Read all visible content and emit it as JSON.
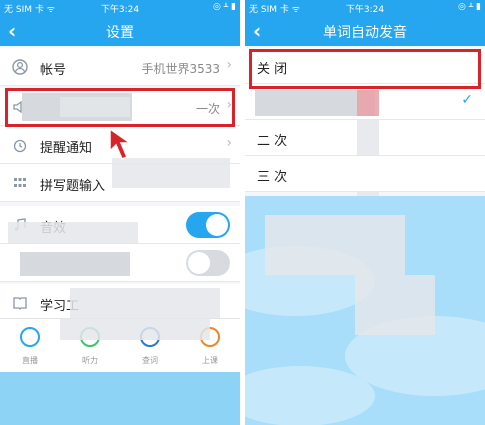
{
  "left": {
    "status": {
      "carrier": "无 SIM 卡 ᯤ",
      "time": "下午3:24",
      "icons": "◎ ᚆ ▮"
    },
    "nav": {
      "back": "‹",
      "title": "设置"
    },
    "rows": {
      "account": {
        "label": "帐号",
        "value": "手机世界3533",
        "icon": "person-icon"
      },
      "speaker": {
        "value": "一次",
        "icon": "speaker-icon"
      },
      "reminder": {
        "label": "提醒通知",
        "icon": "alarm-icon"
      },
      "spelling": {
        "label": "拼写题输入",
        "icon": "keypad-icon"
      },
      "sound": {
        "label": "音效"
      },
      "study": {
        "label": "学习工"
      }
    },
    "tabs": [
      {
        "label": "直播",
        "icon": "live-icon"
      },
      {
        "label": "听力",
        "icon": "listen-icon"
      },
      {
        "label": "查词",
        "icon": "dictionary-icon"
      },
      {
        "label": "上课",
        "icon": "class-icon"
      }
    ]
  },
  "right": {
    "status": {
      "carrier": "无 SIM 卡 ᯤ",
      "time": "下午3:24",
      "icons": "◎ ᚆ ▮"
    },
    "nav": {
      "back": "‹",
      "title": "单词自动发音"
    },
    "options": [
      {
        "label": "关 闭",
        "checked": false
      },
      {
        "label": "",
        "checked": true
      },
      {
        "label": "二 次",
        "checked": false
      },
      {
        "label": "三 次",
        "checked": false
      }
    ],
    "check_symbol": "✓"
  },
  "colors": {
    "primary": "#25a6ef",
    "highlight": "#d9232a",
    "sky": "#a9defa"
  }
}
